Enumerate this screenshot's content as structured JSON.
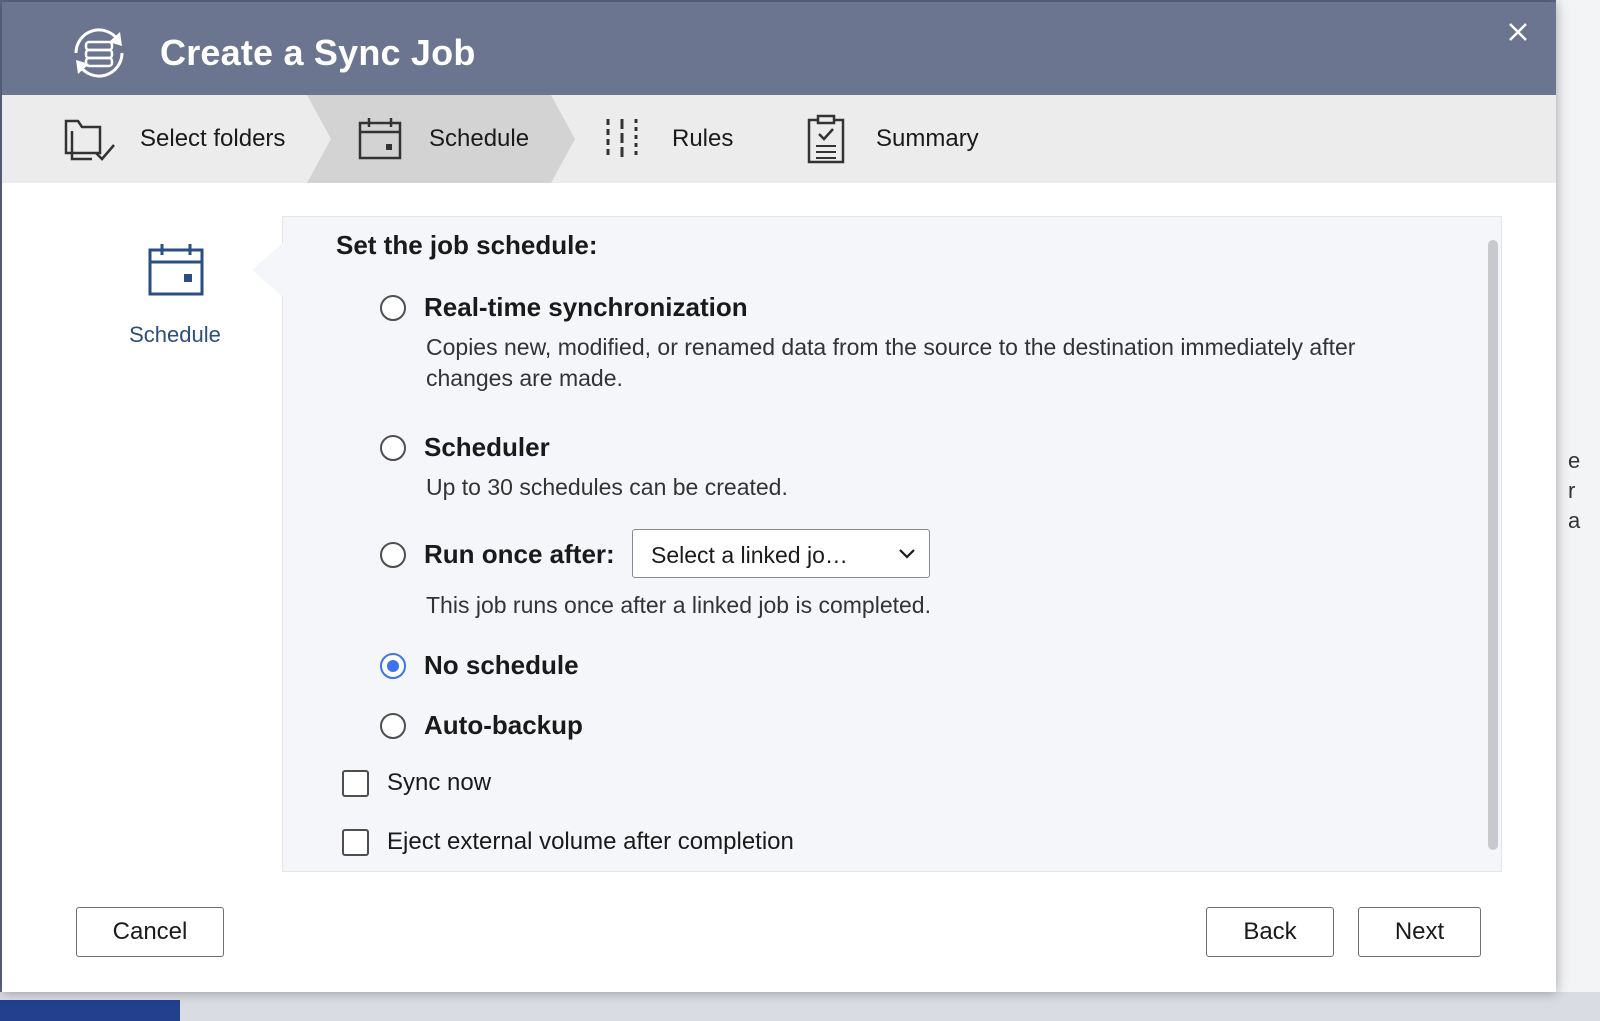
{
  "dialog": {
    "title": "Create a Sync Job",
    "icon": "sync-job-icon",
    "close_icon": "close-icon"
  },
  "steps": [
    {
      "label": "Select folders",
      "icon": "folder-check-icon",
      "active": false
    },
    {
      "label": "Schedule",
      "icon": "calendar-icon",
      "active": true
    },
    {
      "label": "Rules",
      "icon": "sliders-icon",
      "active": false
    },
    {
      "label": "Summary",
      "icon": "clipboard-check-icon",
      "active": false
    }
  ],
  "sidebar": {
    "label": "Schedule",
    "icon": "calendar-icon"
  },
  "panel": {
    "title": "Set the job schedule:",
    "options": [
      {
        "label": "Real-time synchronization",
        "description": "Copies new, modified, or renamed data from the source to the destination immediately after changes are made.",
        "checked": false
      },
      {
        "label": "Scheduler",
        "description": "Up to 30 schedules can be created.",
        "checked": false
      },
      {
        "label": "Run once after:",
        "description": "This job runs once after a linked job is completed.",
        "checked": false
      },
      {
        "label": "No schedule",
        "checked": true
      },
      {
        "label": "Auto-backup",
        "checked": false
      }
    ],
    "linked_job_select": {
      "value": "Select a linked jo…"
    },
    "checkboxes": [
      {
        "label": "Sync now",
        "checked": false
      },
      {
        "label": "Eject external volume after completion",
        "checked": false
      }
    ]
  },
  "footer": {
    "cancel_label": "Cancel",
    "back_label": "Back",
    "next_label": "Next"
  },
  "colors": {
    "titlebar": "#6b7590",
    "accent": "#3c73e8",
    "sidebar_label": "#2b4f80"
  }
}
